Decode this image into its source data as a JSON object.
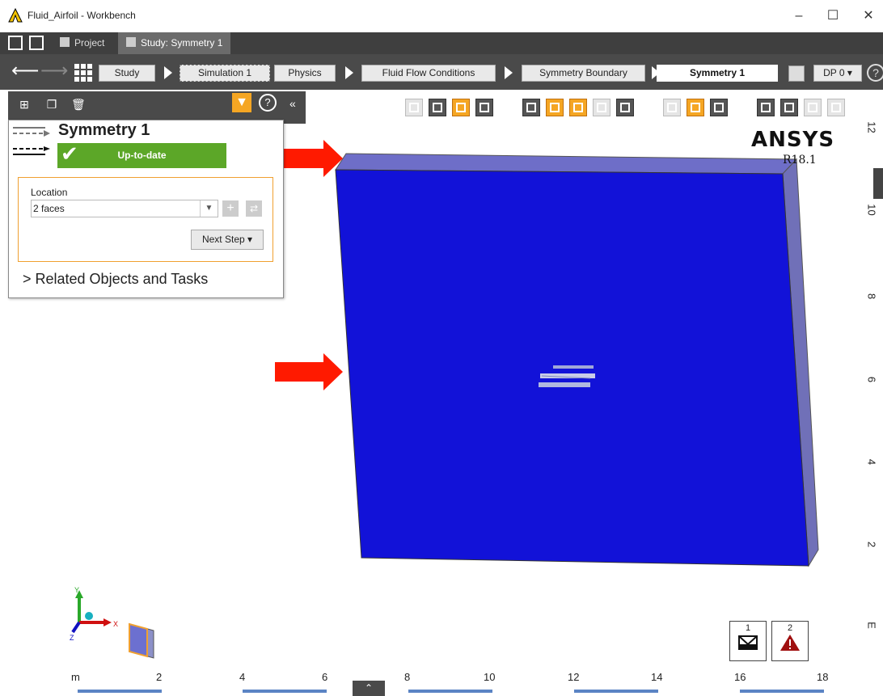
{
  "window": {
    "title": "Fluid_Airfoil - Workbench",
    "minimize": "–",
    "maximize": "☐",
    "close": "✕"
  },
  "tabs": {
    "project": "Project",
    "study": "Study: Symmetry 1"
  },
  "breadcrumb": {
    "items": [
      "Study",
      "Simulation 1",
      "Physics",
      "Fluid Flow Conditions",
      "Symmetry Boundary"
    ],
    "active": "Symmetry 1",
    "dp": "DP 0 ▾",
    "help": "?"
  },
  "panel": {
    "title": "Symmetry 1",
    "status": "Up-to-date",
    "location_label": "Location",
    "location_value": "2 faces",
    "next_step": "Next Step ▾",
    "related": "> Related Objects and Tasks",
    "help": "?",
    "collapse": "«"
  },
  "logo": {
    "name": "ANSYS",
    "version": "R18.1"
  },
  "ruler_right": [
    "12",
    "10",
    "8",
    "6",
    "4",
    "2",
    "E"
  ],
  "ruler_bottom": [
    "m",
    "2",
    "4",
    "6",
    "8",
    "10",
    "12",
    "14",
    "16",
    "18"
  ],
  "messages": [
    {
      "count": "1",
      "icon": "envelope-icon"
    },
    {
      "count": "2",
      "icon": "warning-icon"
    }
  ],
  "bottom_toggle": "⌃",
  "axes": {
    "x": "X",
    "y": "Y",
    "z": "Z"
  },
  "colors": {
    "model_face": "#1212d8",
    "model_edge": "#6a6ad0",
    "status_ok": "#5ca728",
    "accent": "#f5a623",
    "arrow": "#ff1a00"
  }
}
